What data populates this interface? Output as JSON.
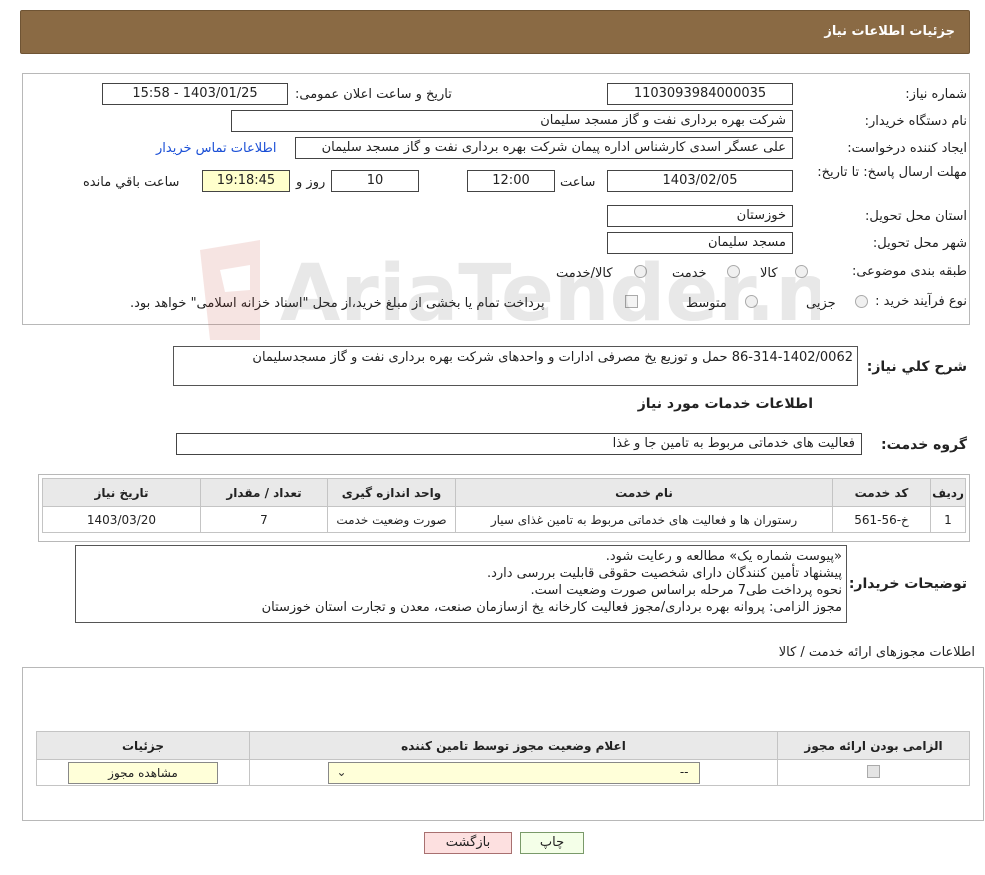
{
  "header": {
    "title": "جزئیات اطلاعات نیاز"
  },
  "fields": {
    "need_number_label": "شماره نیاز:",
    "need_number": "1103093984000035",
    "announce_label": "تاریخ و ساعت اعلان عمومی:",
    "announce_value": "1403/01/25 - 15:58",
    "buyer_org_label": "نام دستگاه خریدار:",
    "buyer_org": "شرکت بهره برداری نفت و گاز مسجد سلیمان",
    "creator_label": "ایجاد کننده درخواست:",
    "creator": "علی عسگر اسدی کارشناس اداره پیمان  شرکت بهره برداری نفت و گاز مسجد سلیمان",
    "contact_link": "اطلاعات تماس خریدار",
    "deadline_label": "مهلت ارسال پاسخ: تا تاریخ:",
    "deadline_date": "1403/02/05",
    "time_label": "ساعت",
    "deadline_time": "12:00",
    "days": "10",
    "days_label": "روز و",
    "remaining_time": "19:18:45",
    "remaining_label": "ساعت باقي مانده",
    "province_label": "استان محل تحویل:",
    "province": "خوزستان",
    "city_label": "شهر محل تحویل:",
    "city": "مسجد سلیمان",
    "category_label": "طبقه بندی موضوعی:",
    "category_options": [
      "کالا",
      "خدمت",
      "کالا/خدمت"
    ],
    "process_label": "نوع فرآیند خرید :",
    "process_options": [
      "جزیی",
      "متوسط"
    ],
    "payment_note": "پرداخت تمام یا بخشی از مبلغ خرید،از محل \"اسناد خزانه اسلامی\" خواهد بود."
  },
  "summary": {
    "label": "شرح كلي نياز:",
    "value": "86-314-1402/0062 حمل و توزیع یخ مصرفی ادارات و واحدهای شرکت بهره برداری نفت و گاز مسجدسلیمان"
  },
  "services": {
    "section_title": "اطلاعات خدمات مورد نیاز",
    "group_label": "گروه خدمت:",
    "group_value": "فعالیت های خدماتی مربوط به تامین جا و غذا",
    "columns": [
      "ردیف",
      "کد خدمت",
      "نام خدمت",
      "واحد اندازه گیری",
      "تعداد / مقدار",
      "تاریخ نیاز"
    ],
    "rows": [
      {
        "row": "1",
        "code": "خ-56-561",
        "name": "رستوران ها و فعالیت های خدماتی مربوط به تامین غذای سیار",
        "unit": "صورت وضعیت خدمت",
        "qty": "7",
        "date": "1403/03/20"
      }
    ]
  },
  "buyer_notes": {
    "label": "توضیحات خریدار:",
    "lines": [
      "«پیوست شماره یک» مطالعه و رعایت شود.",
      "پیشنهاد تأمین کنندگان دارای شخصیت حقوقی قابلیت بررسی دارد.",
      "نحوه پرداخت طی7 مرحله براساس صورت وضعیت است.",
      "مجوز الزامی: پروانه بهره برداری/مجوز فعالیت کارخانه یخ ازسازمان صنعت، معدن و تجارت استان خوزستان"
    ]
  },
  "permits": {
    "section_title": "اطلاعات مجوزهای ارائه خدمت / کالا",
    "columns": [
      "الزامی بودن ارائه مجوز",
      "اعلام وضعیت مجوز توسط تامین کننده",
      "جزئیات"
    ],
    "select_value": "--",
    "view_button": "مشاهده مجوز"
  },
  "buttons": {
    "print": "چاپ",
    "back": "بازگشت"
  },
  "watermark": "AriaTender.neT"
}
